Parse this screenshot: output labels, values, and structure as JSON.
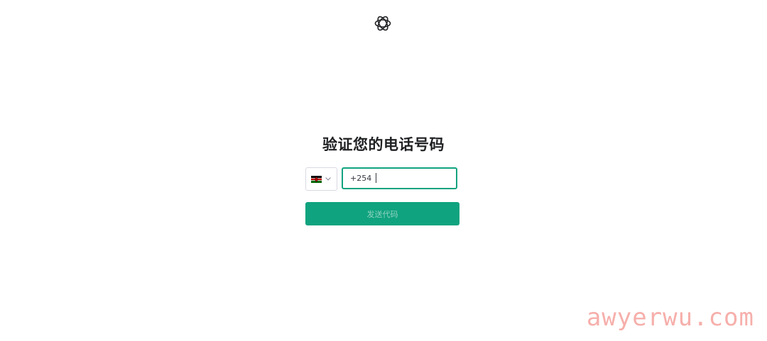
{
  "header": {
    "logo_icon": "openai-logo-icon"
  },
  "main": {
    "title": "验证您的电话号码",
    "country_select": {
      "selected_country_flag": "kenya-flag-icon",
      "dropdown_icon": "chevron-down-icon"
    },
    "phone_input": {
      "value": "+254"
    },
    "send_button_label": "发送代码"
  },
  "watermark": {
    "text": "awyerwu.com"
  },
  "colors": {
    "accent": "#10a37f",
    "button_text_disabled": "#8fd2bf",
    "watermark": "#f6a7a2"
  }
}
